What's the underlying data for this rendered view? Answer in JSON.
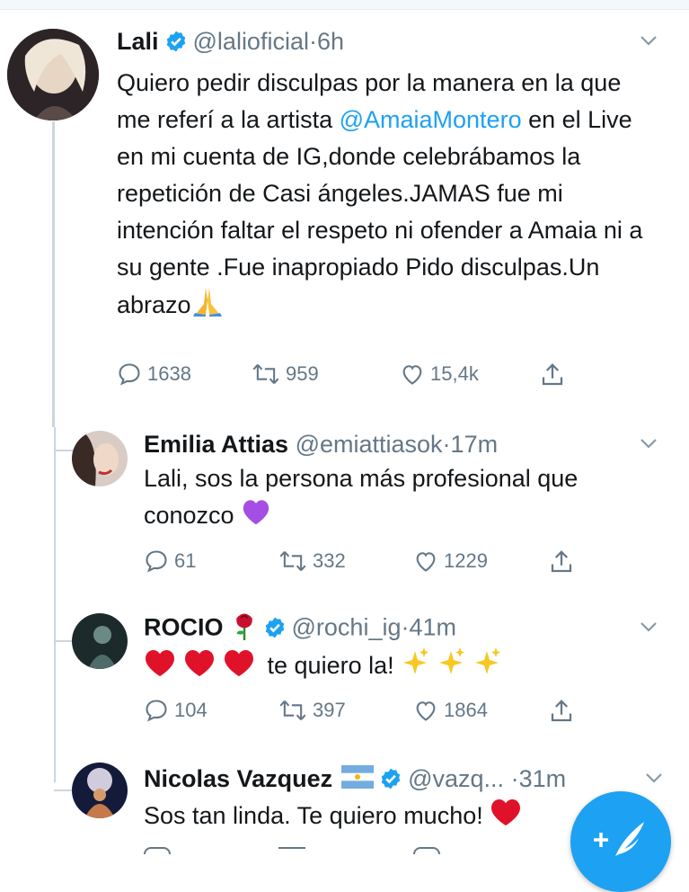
{
  "tweets": [
    {
      "name": "Lali",
      "handle": "@lalioficial",
      "time": "6h",
      "text_before": "Quiero pedir disculpas por la manera en la que me referí a la artista ",
      "mention": "@AmaiaMontero",
      "text_after": " en el Live en mi cuenta de IG,donde celebrábamos la repetición de Casi ángeles.JAMAS fue mi intención faltar el respeto ni ofender a Amaia ni a su gente .Fue inapropiado Pido disculpas.Un abrazo",
      "emoji": "folded-hands-emoji",
      "replies": "1638",
      "retweets": "959",
      "likes": "15,4k"
    },
    {
      "name": "Emilia Attias",
      "handle": "@emiattiasok",
      "time": "17m",
      "text": "Lali, sos la persona más profesional que conozco",
      "emoji": "purple-heart-emoji",
      "replies": "61",
      "retweets": "332",
      "likes": "1229"
    },
    {
      "name": "ROCIO",
      "name_emoji": "rose-emoji",
      "handle": "@rochi_ig",
      "time": "41m",
      "text": "te quiero la!",
      "emoji": "red-hearts-and-sparkles",
      "replies": "104",
      "retweets": "397",
      "likes": "1864"
    },
    {
      "name": "Nicolas Vazquez",
      "name_emoji": "argentina-flag-emoji",
      "handle": "@vazq...",
      "time": "31m",
      "text": "Sos tan linda. Te quiero mucho!",
      "emoji": "red-heart-emoji"
    }
  ],
  "dot": "·",
  "colors": {
    "accent": "#1da1f2",
    "muted": "#657786",
    "text": "#14171a",
    "thread": "#ccd6dd"
  },
  "fab": {
    "icon": "compose-tweet-icon"
  }
}
